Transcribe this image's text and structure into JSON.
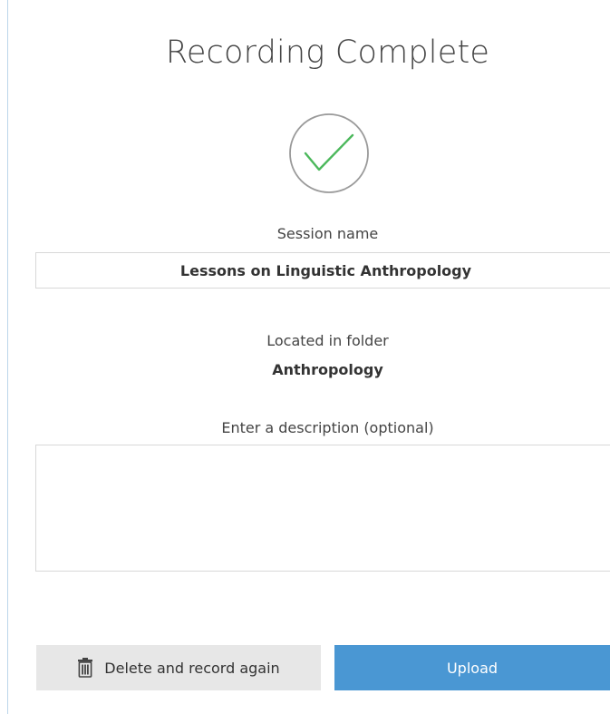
{
  "dialog": {
    "title": "Recording Complete",
    "check_icon": "checkmark-circle-icon",
    "check_color": "#4cb85c"
  },
  "session": {
    "label": "Session name",
    "value": "Lessons on Linguistic Anthropology"
  },
  "folder": {
    "label": "Located in folder",
    "value": "Anthropology"
  },
  "description": {
    "label": "Enter a description (optional)",
    "value": "",
    "placeholder": ""
  },
  "actions": {
    "delete_label": "Delete and record again",
    "delete_icon": "trash-icon",
    "upload_label": "Upload",
    "upload_color": "#4a97d3"
  }
}
